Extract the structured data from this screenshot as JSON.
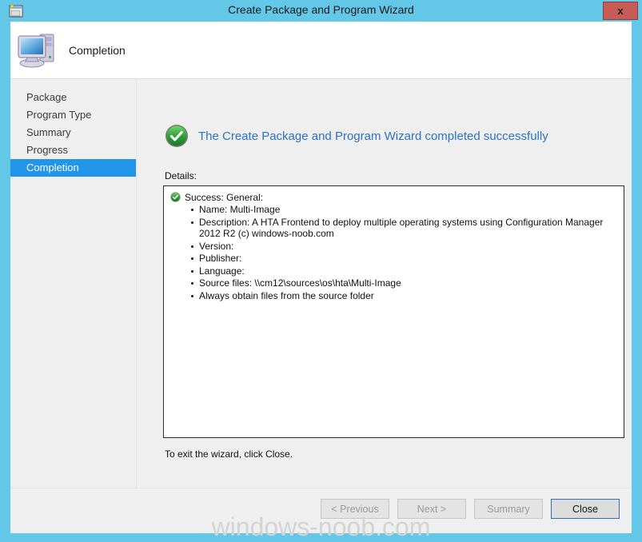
{
  "window": {
    "title": "Create Package and Program Wizard",
    "icon": "wizard-package-icon",
    "close_label": "x"
  },
  "header": {
    "title": "Completion",
    "icon": "computer-icon"
  },
  "sidebar": {
    "items": [
      {
        "label": "Package",
        "active": false
      },
      {
        "label": "Program Type",
        "active": false
      },
      {
        "label": "Summary",
        "active": false
      },
      {
        "label": "Progress",
        "active": false
      },
      {
        "label": "Completion",
        "active": true
      }
    ]
  },
  "main": {
    "success_heading": "The Create Package and Program Wizard completed successfully",
    "success_icon": "green-check-circle-icon",
    "details_label": "Details:",
    "details": {
      "group_icon": "green-check-circle-icon",
      "group_title": "Success: General:",
      "items": [
        "Name: Multi-Image",
        "Description: A HTA Frontend to deploy multiple operating systems using Configuration Manager 2012 R2 (c) windows-noob.com",
        "Version:",
        "Publisher:",
        "Language:",
        "Source files: \\\\cm12\\sources\\os\\hta\\Multi-Image",
        "Always obtain files from the source folder"
      ]
    },
    "exit_note": "To exit the wizard, click Close."
  },
  "footer": {
    "buttons": [
      {
        "label": "< Previous",
        "enabled": false
      },
      {
        "label": "Next >",
        "enabled": false
      },
      {
        "label": "Summary",
        "enabled": false
      },
      {
        "label": "Close",
        "enabled": true
      }
    ]
  },
  "watermark": {
    "text": "windows-noob.com"
  },
  "colors": {
    "titlebar": "#63c8e8",
    "close_button": "#c75b55",
    "accent_blue": "#2196e8",
    "heading_blue": "#2a72c4",
    "success_green": "#2eae34"
  }
}
